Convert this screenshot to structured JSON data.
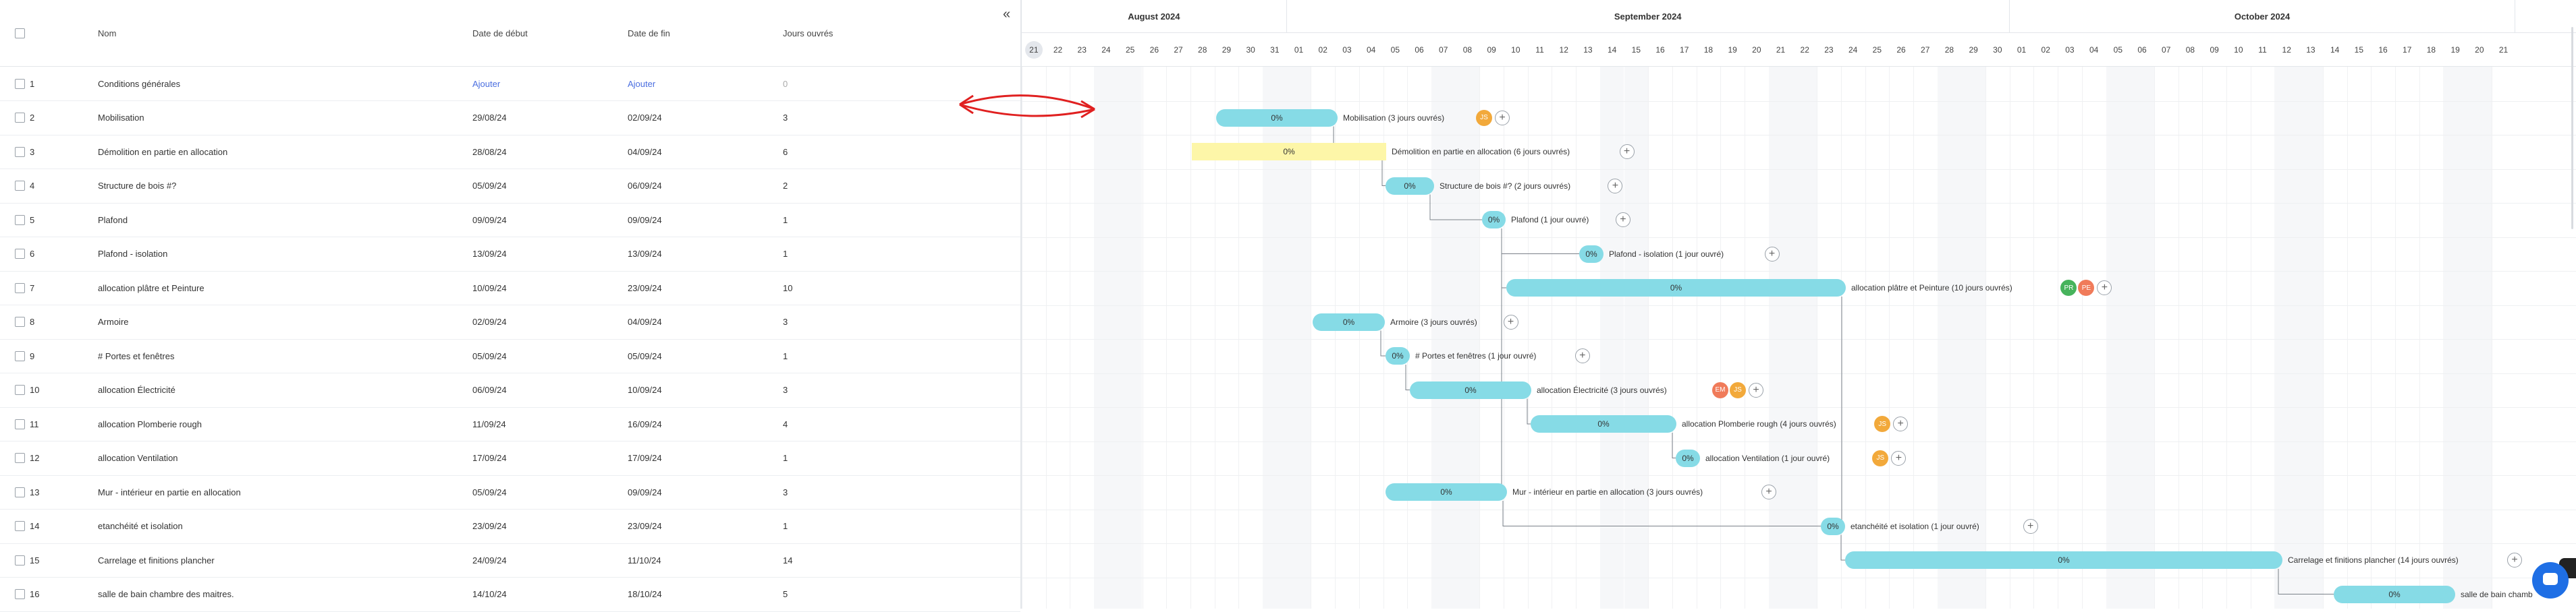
{
  "headers": {
    "num": "",
    "name": "Nom",
    "start": "Date de début",
    "end": "Date de fin",
    "days": "Jours ouvrés"
  },
  "collapse_icon": "«",
  "rows": [
    {
      "num": "1",
      "name": "Conditions générales",
      "start": "Ajouter",
      "end": "Ajouter",
      "days": "0"
    },
    {
      "num": "2",
      "name": "Mobilisation",
      "start": "29/08/24",
      "end": "02/09/24",
      "days": "3"
    },
    {
      "num": "3",
      "name": "Démolition en partie en allocation",
      "start": "28/08/24",
      "end": "04/09/24",
      "days": "6"
    },
    {
      "num": "4",
      "name": "Structure de bois #?",
      "start": "05/09/24",
      "end": "06/09/24",
      "days": "2"
    },
    {
      "num": "5",
      "name": "Plafond",
      "start": "09/09/24",
      "end": "09/09/24",
      "days": "1"
    },
    {
      "num": "6",
      "name": "Plafond - isolation",
      "start": "13/09/24",
      "end": "13/09/24",
      "days": "1"
    },
    {
      "num": "7",
      "name": "allocation plâtre et Peinture",
      "start": "10/09/24",
      "end": "23/09/24",
      "days": "10"
    },
    {
      "num": "8",
      "name": "Armoire",
      "start": "02/09/24",
      "end": "04/09/24",
      "days": "3"
    },
    {
      "num": "9",
      "name": "# Portes et fenêtres",
      "start": "05/09/24",
      "end": "05/09/24",
      "days": "1"
    },
    {
      "num": "10",
      "name": "allocation  Électricité",
      "start": "06/09/24",
      "end": "10/09/24",
      "days": "3"
    },
    {
      "num": "11",
      "name": "allocation Plomberie rough",
      "start": "11/09/24",
      "end": "16/09/24",
      "days": "4"
    },
    {
      "num": "12",
      "name": "allocation Ventilation",
      "start": "17/09/24",
      "end": "17/09/24",
      "days": "1"
    },
    {
      "num": "13",
      "name": "Mur - intérieur en partie en allocation",
      "start": "05/09/24",
      "end": "09/09/24",
      "days": "3"
    },
    {
      "num": "14",
      "name": "etanchéité et isolation",
      "start": "23/09/24",
      "end": "23/09/24",
      "days": "1"
    },
    {
      "num": "15",
      "name": "Carrelage et finitions plancher",
      "start": "24/09/24",
      "end": "11/10/24",
      "days": "14"
    },
    {
      "num": "16",
      "name": "salle de bain chambre des maitres.",
      "start": "14/10/24",
      "end": "18/10/24",
      "days": "5"
    }
  ],
  "months": [
    {
      "label": "August 2024"
    },
    {
      "label": "September 2024"
    },
    {
      "label": "October 2024"
    }
  ],
  "days": [
    "21",
    "22",
    "23",
    "24",
    "25",
    "26",
    "27",
    "28",
    "29",
    "30",
    "31",
    "01",
    "02",
    "03",
    "04",
    "05",
    "06",
    "07",
    "08",
    "09",
    "10",
    "11",
    "12",
    "13",
    "14",
    "15",
    "16",
    "17",
    "18",
    "19",
    "20",
    "21",
    "22",
    "23",
    "24",
    "25",
    "26",
    "27",
    "28",
    "29",
    "30",
    "01",
    "02",
    "03",
    "04",
    "05",
    "06",
    "07",
    "08",
    "09",
    "10",
    "11",
    "12",
    "13",
    "14",
    "15",
    "16",
    "17",
    "18",
    "19",
    "20",
    "21"
  ],
  "bars": [
    {
      "row": 1,
      "pct": "0%",
      "label": "Mobilisation  (3 jours ouvrés)",
      "avatars": [
        {
          "t": "JS",
          "c": "#f2a93b"
        }
      ]
    },
    {
      "row": 2,
      "pct": "0%",
      "label": "Démolition en partie en allocation  (6 jours ouvrés)",
      "avatars": []
    },
    {
      "row": 3,
      "pct": "0%",
      "label": "Structure de bois #?  (2 jours ouvrés)",
      "avatars": []
    },
    {
      "row": 4,
      "pct": "0%",
      "label": "Plafond  (1 jour ouvré)",
      "avatars": []
    },
    {
      "row": 5,
      "pct": "0%",
      "label": "Plafond - isolation  (1 jour ouvré)",
      "avatars": []
    },
    {
      "row": 6,
      "pct": "0%",
      "label": "allocation plâtre et Peinture  (10 jours ouvrés)",
      "avatars": [
        {
          "t": "PR",
          "c": "#47b35c"
        },
        {
          "t": "PE",
          "c": "#f07b5a"
        }
      ]
    },
    {
      "row": 7,
      "pct": "0%",
      "label": "Armoire  (3 jours ouvrés)",
      "avatars": []
    },
    {
      "row": 8,
      "pct": "0%",
      "label": "# Portes et fenêtres  (1 jour ouvré)",
      "avatars": []
    },
    {
      "row": 9,
      "pct": "0%",
      "label": "allocation Électricité  (3 jours ouvrés)",
      "avatars": [
        {
          "t": "EM",
          "c": "#f07b5a"
        },
        {
          "t": "JS",
          "c": "#f2a93b"
        }
      ]
    },
    {
      "row": 10,
      "pct": "0%",
      "label": "allocation Plomberie rough  (4 jours ouvrés)",
      "avatars": [
        {
          "t": "JS",
          "c": "#f2a93b"
        }
      ]
    },
    {
      "row": 11,
      "pct": "0%",
      "label": "allocation Ventilation  (1 jour ouvré)",
      "avatars": [
        {
          "t": "JS",
          "c": "#f2a93b"
        }
      ]
    },
    {
      "row": 12,
      "pct": "0%",
      "label": "Mur - intérieur en partie en allocation  (3 jours ouvrés)",
      "avatars": []
    },
    {
      "row": 13,
      "pct": "0%",
      "label": "etanchéité et isolation  (1 jour ouvré)",
      "avatars": []
    },
    {
      "row": 14,
      "pct": "0%",
      "label": "Carrelage et finitions plancher  (14 jours ouvrés)",
      "avatars": []
    },
    {
      "row": 15,
      "pct": "0%",
      "label": "salle de bain chamb",
      "avatars": []
    }
  ],
  "colors": {
    "bar": "#86dbe6",
    "bar_highlight": "#fdf6a8",
    "arrow": "#e02020",
    "link": "#4a6ee0"
  }
}
